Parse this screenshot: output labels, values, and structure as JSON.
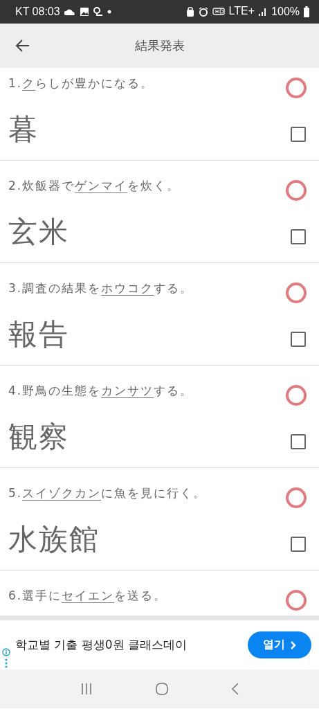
{
  "status_bar": {
    "carrier_time": "KT 08:03",
    "network": "LTE+",
    "battery": "100%"
  },
  "app_bar": {
    "title": "結果発表"
  },
  "questions": [
    {
      "number": "1.",
      "underlined": "ク",
      "after": "らしが豊かになる。",
      "correct": true,
      "answer": "暮",
      "checked": false
    },
    {
      "number": "2.",
      "before": "炊飯器で",
      "underlined": "ゲンマイ",
      "after": "を炊く。",
      "correct": true,
      "answer": "玄米",
      "checked": false
    },
    {
      "number": "3.",
      "before": "調査の結果を",
      "underlined": "ホウコク",
      "after": "する。",
      "correct": true,
      "answer": "報告",
      "checked": false
    },
    {
      "number": "4.",
      "before": "野鳥の生態を",
      "underlined": "カンサツ",
      "after": "する。",
      "correct": true,
      "answer": "観察",
      "checked": false
    },
    {
      "number": "5.",
      "underlined": "スイゾクカン",
      "after": "に魚を見に行く。",
      "correct": true,
      "answer": "水族館",
      "checked": false
    },
    {
      "number": "6.",
      "before": "選手に",
      "underlined": "セイエン",
      "after": "を送る。",
      "correct": true
    }
  ],
  "ad": {
    "text": "학교별 기출 평생0원 클래스데이",
    "button": "열기"
  }
}
